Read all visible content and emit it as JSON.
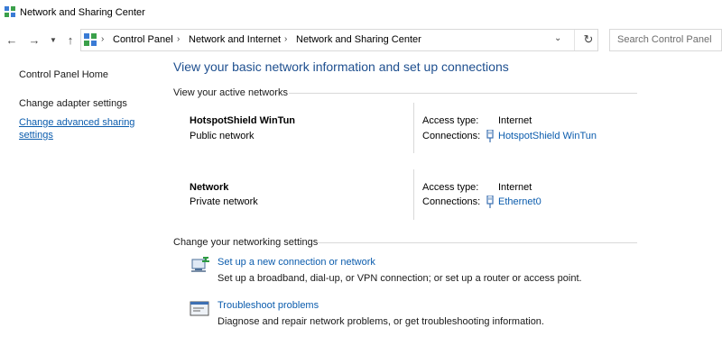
{
  "window": {
    "title": "Network and Sharing Center"
  },
  "address_bar": {
    "crumbs": [
      "Control Panel",
      "Network and Internet",
      "Network and Sharing Center"
    ]
  },
  "search": {
    "placeholder": "Search Control Panel"
  },
  "left_pane": {
    "home": "Control Panel Home",
    "adapter": "Change adapter settings",
    "advanced": "Change advanced sharing settings"
  },
  "main": {
    "title": "View your basic network information and set up connections",
    "active_label": "View your active networks",
    "networks": [
      {
        "name": "HotspotShield WinTun",
        "type": "Public network",
        "access_label": "Access type:",
        "access_value": "Internet",
        "connections_label": "Connections:",
        "connection": "HotspotShield WinTun"
      },
      {
        "name": "Network",
        "type": "Private network",
        "access_label": "Access type:",
        "access_value": "Internet",
        "connections_label": "Connections:",
        "connection": "Ethernet0"
      }
    ],
    "change_label": "Change your networking settings",
    "tasks": [
      {
        "icon": "new-connection-icon",
        "link": "Set up a new connection or network",
        "desc": "Set up a broadband, dial-up, or VPN connection; or set up a router or access point."
      },
      {
        "icon": "troubleshoot-icon",
        "link": "Troubleshoot problems",
        "desc": "Diagnose and repair network problems, or get troubleshooting information."
      }
    ]
  },
  "colors": {
    "link": "#0b5cad",
    "title": "#1e4f8f"
  }
}
